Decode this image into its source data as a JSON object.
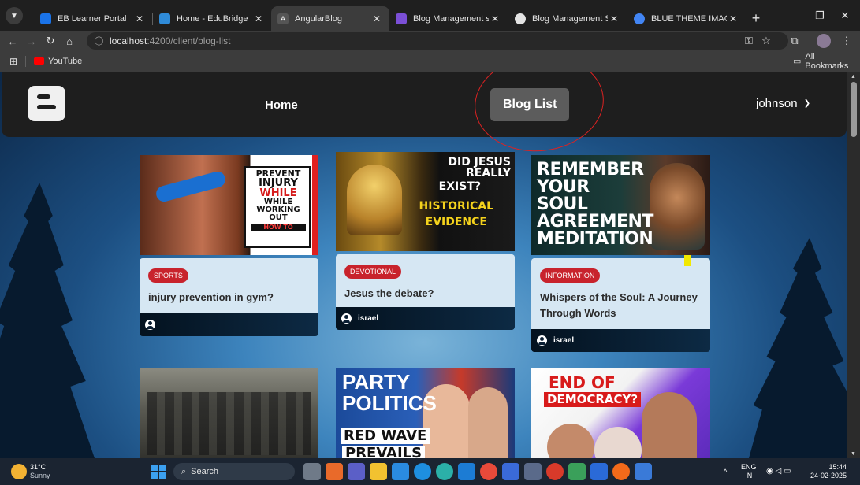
{
  "browser": {
    "tabs": [
      {
        "title": "EB Learner Portal",
        "color": "#1a73e8",
        "active": false
      },
      {
        "title": "Home - EduBridge",
        "color": "#2f8bd8",
        "active": false
      },
      {
        "title": "AngularBlog",
        "color": "#555555",
        "active": true
      },
      {
        "title": "Blog Management system",
        "color": "#7b4fd6",
        "active": false
      },
      {
        "title": "Blog Management System",
        "color": "#e3e3e3",
        "active": false
      },
      {
        "title": "BLUE THEME IMAGE OG H",
        "color": "#4285f4",
        "active": false
      }
    ],
    "url_host": "localhost",
    "url_path": ":4200/client/blog-list",
    "bookmark_youtube": "YouTube",
    "bookmark_all": "All Bookmarks"
  },
  "navbar": {
    "home_label": "Home",
    "blog_list_label": "Blog List",
    "user_name": "johnson"
  },
  "posts": [
    {
      "category": "SPORTS",
      "title": "injury prevention in gym?",
      "author": "",
      "image_text": [
        "PREVENT",
        "INJURY",
        "WHILE",
        "WHILE",
        "WORKING",
        "OUT",
        "HOW TO"
      ]
    },
    {
      "category": "DEVOTIONAL",
      "title": "Jesus the debate?",
      "author": "israel",
      "image_text": [
        "DID JESUS REALLY",
        "EXIST?",
        "HISTORICAL",
        "EVIDENCE"
      ]
    },
    {
      "category": "INFORMATION",
      "title": "Whispers of the Soul: A Journey Through Words",
      "author": "israel",
      "image_text": [
        "REMEMBER",
        "YOUR",
        "SOUL",
        "AGREEMENT",
        "MEDITATION"
      ]
    },
    {
      "category": "",
      "title": "",
      "author": "",
      "image_text": []
    },
    {
      "category": "",
      "title": "",
      "author": "",
      "image_text": [
        "PARTY",
        "POLITICS",
        "RED WAVE",
        "PREVAILS"
      ]
    },
    {
      "category": "",
      "title": "",
      "author": "",
      "image_text": [
        "END OF",
        "DEMOCRACY?"
      ]
    }
  ],
  "taskbar": {
    "weather_temp": "31°C",
    "weather_desc": "Sunny",
    "search_label": "Search",
    "lang_1": "ENG",
    "lang_2": "IN",
    "time": "15:44",
    "date": "24-02-2025"
  },
  "colors": {
    "accent_badge": "#c8232c",
    "navbar_bg": "#1e1e1e",
    "annotation": "#dd2222"
  }
}
